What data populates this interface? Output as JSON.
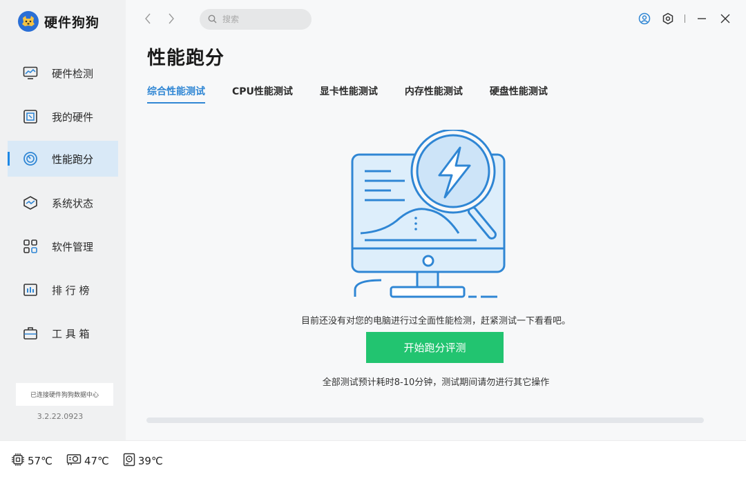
{
  "app": {
    "name": "硬件狗狗",
    "version": "3.2.22.0923",
    "connection_status": "已连接硬件狗狗数据中心"
  },
  "sidebar": {
    "items": [
      {
        "label": "硬件检测",
        "icon": "monitor-icon",
        "active": false
      },
      {
        "label": "我的硬件",
        "icon": "hardware-icon",
        "active": false
      },
      {
        "label": "性能跑分",
        "icon": "speedometer-icon",
        "active": true
      },
      {
        "label": "系统状态",
        "icon": "system-status-icon",
        "active": false
      },
      {
        "label": "软件管理",
        "icon": "apps-grid-icon",
        "active": false
      },
      {
        "label": "排 行 榜",
        "icon": "ranking-icon",
        "active": false
      },
      {
        "label": "工 具 箱",
        "icon": "toolbox-icon",
        "active": false
      }
    ]
  },
  "header": {
    "search_placeholder": "搜索"
  },
  "main": {
    "title": "性能跑分",
    "tabs": [
      {
        "label": "综合性能测试",
        "active": true
      },
      {
        "label": "CPU性能测试",
        "active": false
      },
      {
        "label": "显卡性能测试",
        "active": false
      },
      {
        "label": "内存性能测试",
        "active": false
      },
      {
        "label": "硬盘性能测试",
        "active": false
      }
    ],
    "empty_message": "目前还没有对您的电脑进行过全面性能检测，赶紧测试一下看看吧。",
    "start_button": "开始跑分评测",
    "hint": "全部测试预计耗时8-10分钟，测试期间请勿进行其它操作",
    "progress": 0
  },
  "statusbar": {
    "temps": [
      {
        "icon": "cpu-icon",
        "value": "57℃"
      },
      {
        "icon": "gpu-icon",
        "value": "47℃"
      },
      {
        "icon": "disk-icon",
        "value": "39℃"
      }
    ]
  },
  "colors": {
    "accent": "#2f86d4",
    "active_nav_bg": "#d9e9f7",
    "start_button": "#22c470"
  }
}
